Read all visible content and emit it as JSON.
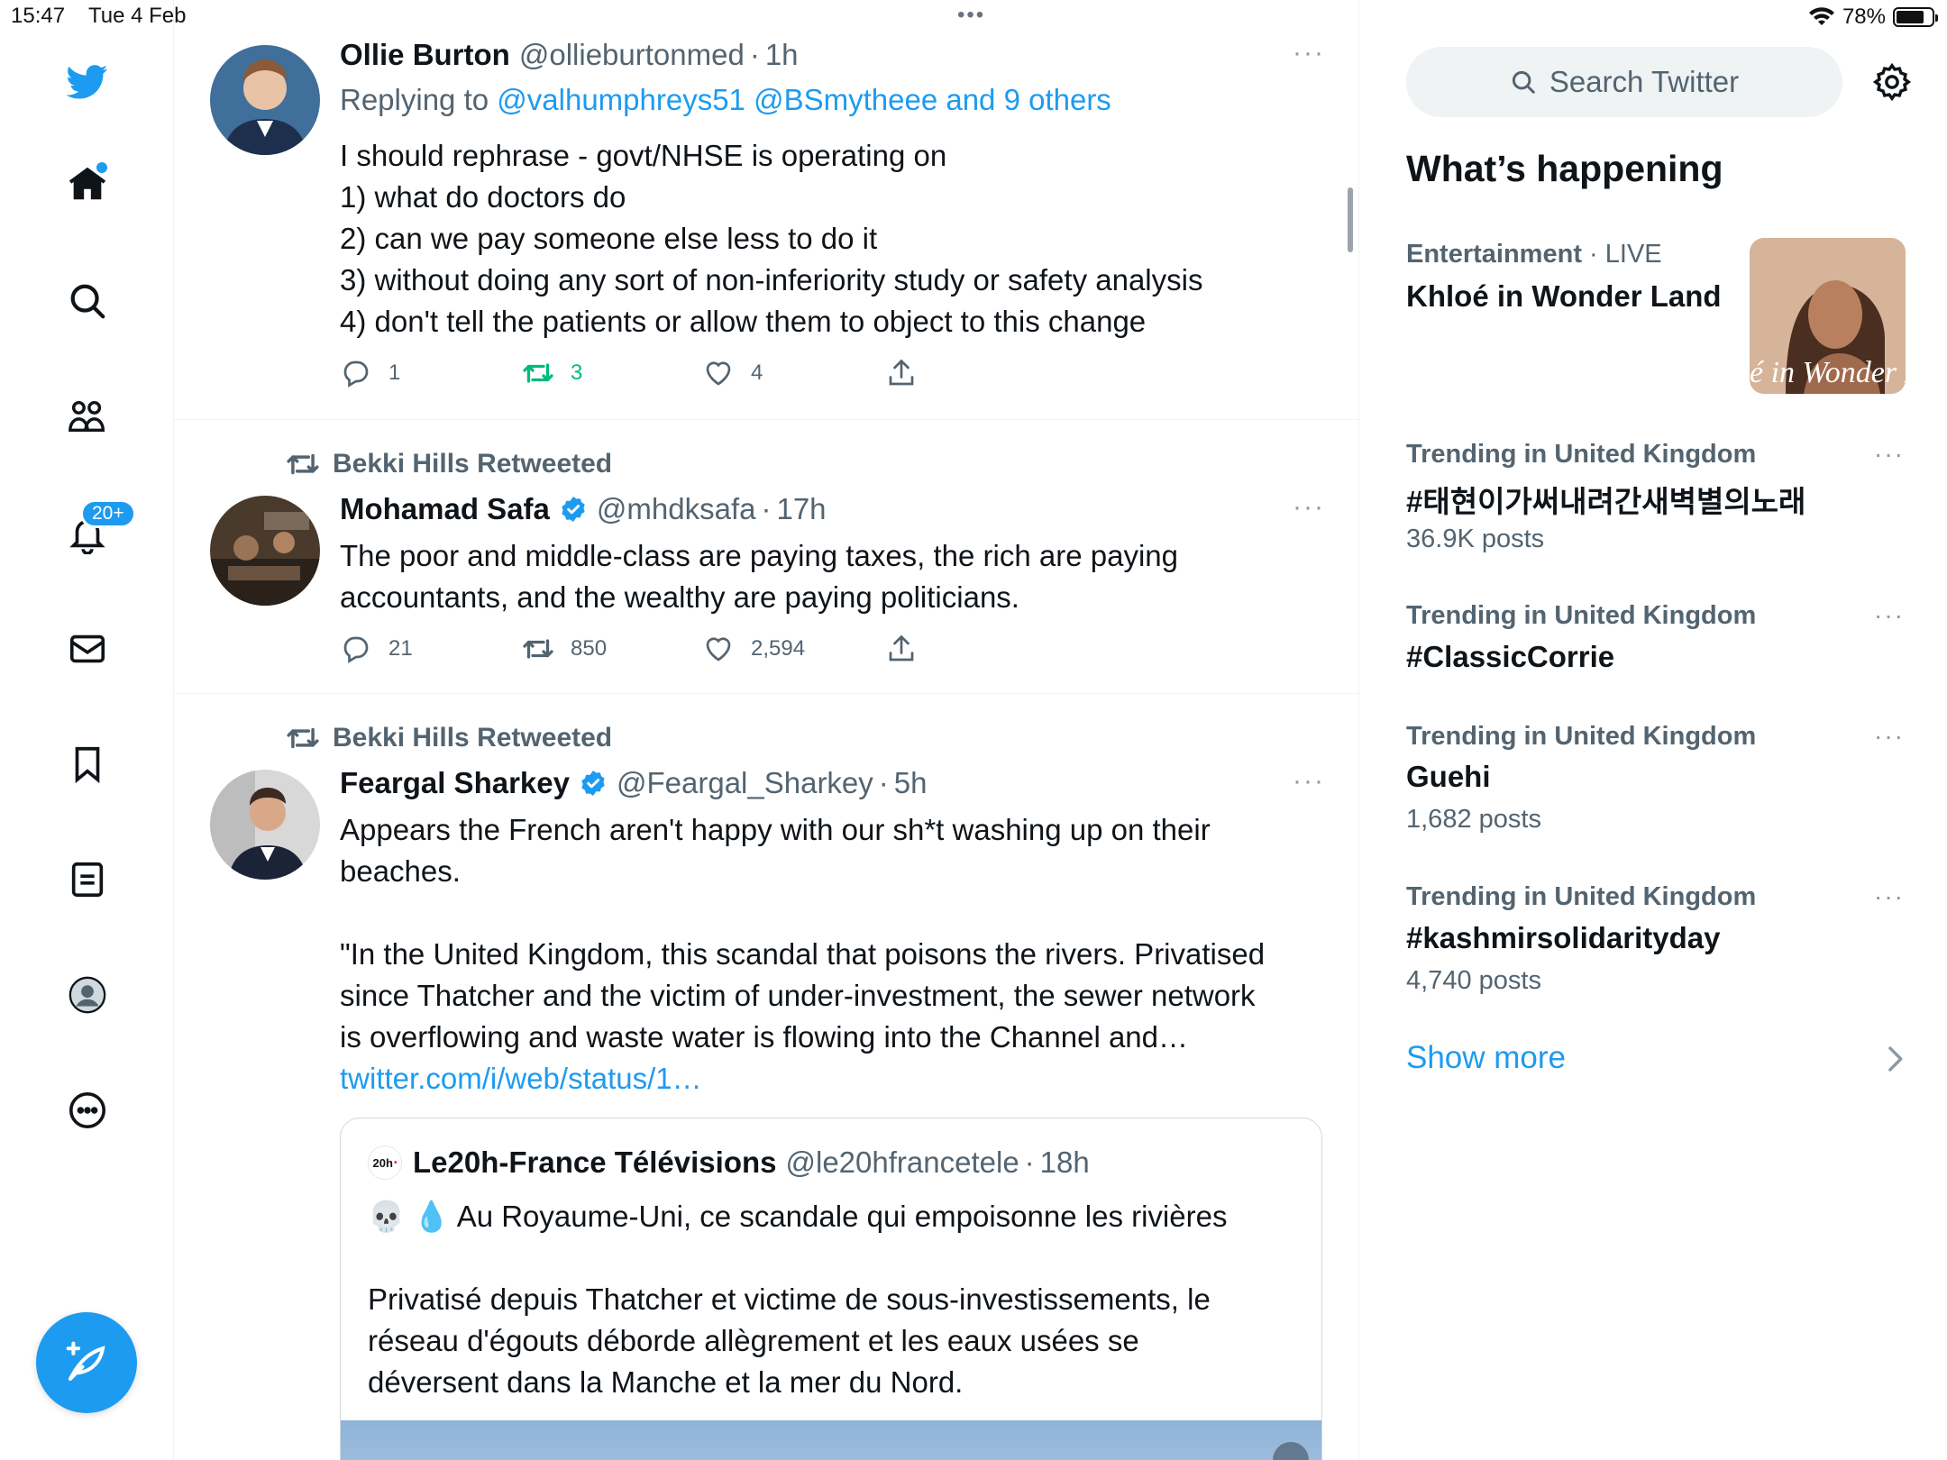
{
  "status": {
    "time": "15:47",
    "date": "Tue 4 Feb",
    "dots": "•••",
    "battery": "78%",
    "battery_level": 0.78
  },
  "nav": {
    "home_badge": true,
    "notifications_badge": "20+",
    "items": [
      "twitter-logo",
      "home",
      "explore",
      "communities",
      "notifications",
      "messages",
      "bookmarks",
      "lists",
      "profile",
      "more"
    ]
  },
  "tweets": [
    {
      "name": "Ollie Burton",
      "handle": "@ollieburtonmed",
      "sep": "·",
      "time": "1h",
      "more": "···",
      "reply_prefix": "Replying to",
      "reply_links": "@valhumphreys51 @BSmytheee and 9 others",
      "lines": [
        "I should rephrase - govt/NHSE is operating on",
        "1) what do doctors do",
        "2) can we pay someone else less to do it",
        "3) without doing any sort of non-inferiority study or safety analysis",
        "4) don't tell the patients or allow them to object to this change"
      ],
      "replies": "1",
      "retweets": "3",
      "likes": "4",
      "retweeted_by_me": true
    },
    {
      "retweeted_by": "Bekki Hills Retweeted",
      "name": "Mohamad Safa",
      "verified": true,
      "handle": "@mhdksafa",
      "sep": "·",
      "time": "17h",
      "more": "···",
      "lines": [
        "The poor and middle-class are paying taxes, the rich are paying",
        "accountants, and the wealthy are paying politicians."
      ],
      "replies": "21",
      "retweets": "850",
      "likes": "2,594"
    },
    {
      "retweeted_by": "Bekki Hills Retweeted",
      "name": "Feargal Sharkey",
      "verified": true,
      "handle": "@Feargal_Sharkey",
      "sep": "·",
      "time": "5h",
      "more": "···",
      "lines": [
        "Appears the French aren't happy with our sh*t washing up on their",
        "beaches.",
        "",
        "\"In the United Kingdom, this scandal that poisons the rivers. Privatised",
        "since Thatcher and the victim of under-investment, the sewer network",
        "is overflowing and waste water is flowing into the Channel and…"
      ],
      "link": "twitter.com/i/web/status/1…",
      "quote": {
        "logo_text": "20h",
        "logo_dot": "•",
        "name": "Le20h-France Télévisions",
        "handle": "@le20hfrancetele",
        "sep": "·",
        "time": "18h",
        "line1": "💀 💧 Au Royaume-Uni, ce scandale qui empoisonne les rivières",
        "lines": [
          "Privatisé depuis Thatcher et victime de sous-investissements, le",
          "réseau d'égouts déborde allègrement et les eaux usées se",
          "déversent dans la Manche et la mer du Nord."
        ]
      }
    }
  ],
  "sidebar": {
    "search_placeholder": "Search Twitter",
    "title": "What’s happening",
    "featured": {
      "category": "Entertainment",
      "sep": "·",
      "live": "LIVE",
      "name": "Khloé in Wonder Land",
      "image_caption": "é in Wonder L"
    },
    "trends": [
      {
        "category": "Trending in United Kingdom",
        "name": "#태현이가써내려간새벽별의노래",
        "count": "36.9K posts"
      },
      {
        "category": "Trending in United Kingdom",
        "name": "#ClassicCorrie",
        "count": ""
      },
      {
        "category": "Trending in United Kingdom",
        "name": "Guehi",
        "count": "1,682 posts"
      },
      {
        "category": "Trending in United Kingdom",
        "name": "#kashmirsolidarityday",
        "count": "4,740 posts"
      }
    ],
    "more": "···",
    "show_more": "Show more"
  },
  "colors": {
    "accent": "#1d9bf0",
    "retweet_active": "#00ba7c",
    "muted": "#536471",
    "text": "#0f1419"
  }
}
